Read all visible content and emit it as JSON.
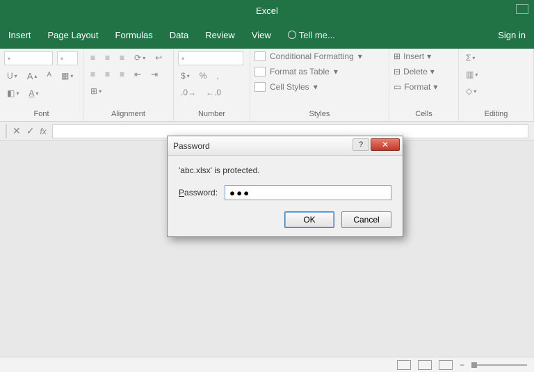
{
  "app": {
    "title": "Excel",
    "signin": "Sign in"
  },
  "tabs": {
    "insert": "Insert",
    "pagelayout": "Page Layout",
    "formulas": "Formulas",
    "data": "Data",
    "review": "Review",
    "view": "View",
    "tellme": "Tell me..."
  },
  "ribbon": {
    "font": {
      "label": "Font",
      "u": "U",
      "a_inc": "A",
      "a_dec": "A"
    },
    "alignment": {
      "label": "Alignment"
    },
    "number": {
      "label": "Number",
      "currency": "$",
      "percent": "%",
      "comma": ","
    },
    "styles": {
      "label": "Styles",
      "cond": "Conditional Formatting",
      "table": "Format as Table",
      "cell": "Cell Styles"
    },
    "cells": {
      "label": "Cells",
      "insert": "Insert",
      "delete": "Delete",
      "format": "Format"
    },
    "editing": {
      "label": "Editing",
      "sum": "Σ"
    }
  },
  "formula": {
    "cancel": "✕",
    "accept": "✓",
    "fx": "fx"
  },
  "dialog": {
    "title": "Password",
    "message": "'abc.xlsx' is protected.",
    "pwd_label_pre": "P",
    "pwd_label_post": "assword:",
    "pwd_value": "●●●",
    "ok": "OK",
    "cancel": "Cancel",
    "help": "?",
    "close": "✕"
  }
}
